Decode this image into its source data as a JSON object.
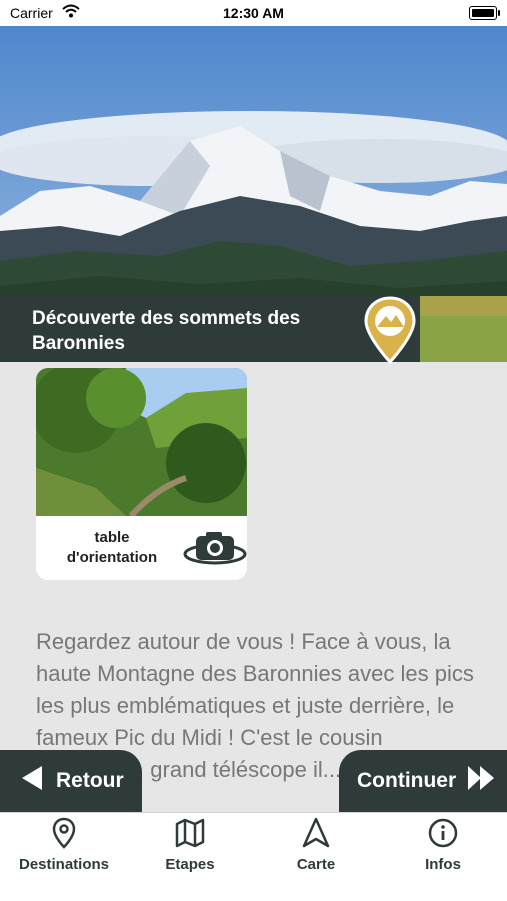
{
  "status_bar": {
    "carrier": "Carrier",
    "time": "12:30 AM"
  },
  "header": {
    "title": "Découverte des sommets des Baronnies"
  },
  "card": {
    "label": "table d'orientation"
  },
  "description": "Regardez autour de vous ! Face à vous, la haute Montagne des Baronnies avec les pics les plus emblématiques et juste derrière, le fameux Pic du Midi ! C'est le cousin d'Yvonne... grand téléscope il...",
  "buttons": {
    "back": "Retour",
    "next": "Continuer"
  },
  "tabs": [
    {
      "label": "Destinations",
      "icon": "map-pin-icon"
    },
    {
      "label": "Etapes",
      "icon": "folded-map-icon"
    },
    {
      "label": "Carte",
      "icon": "navigation-arrow-icon"
    },
    {
      "label": "Infos",
      "icon": "info-icon"
    }
  ],
  "colors": {
    "dark_panel": "#2f3b3b",
    "accent_gold": "#d9b24c",
    "background": "#e6e6e6"
  }
}
